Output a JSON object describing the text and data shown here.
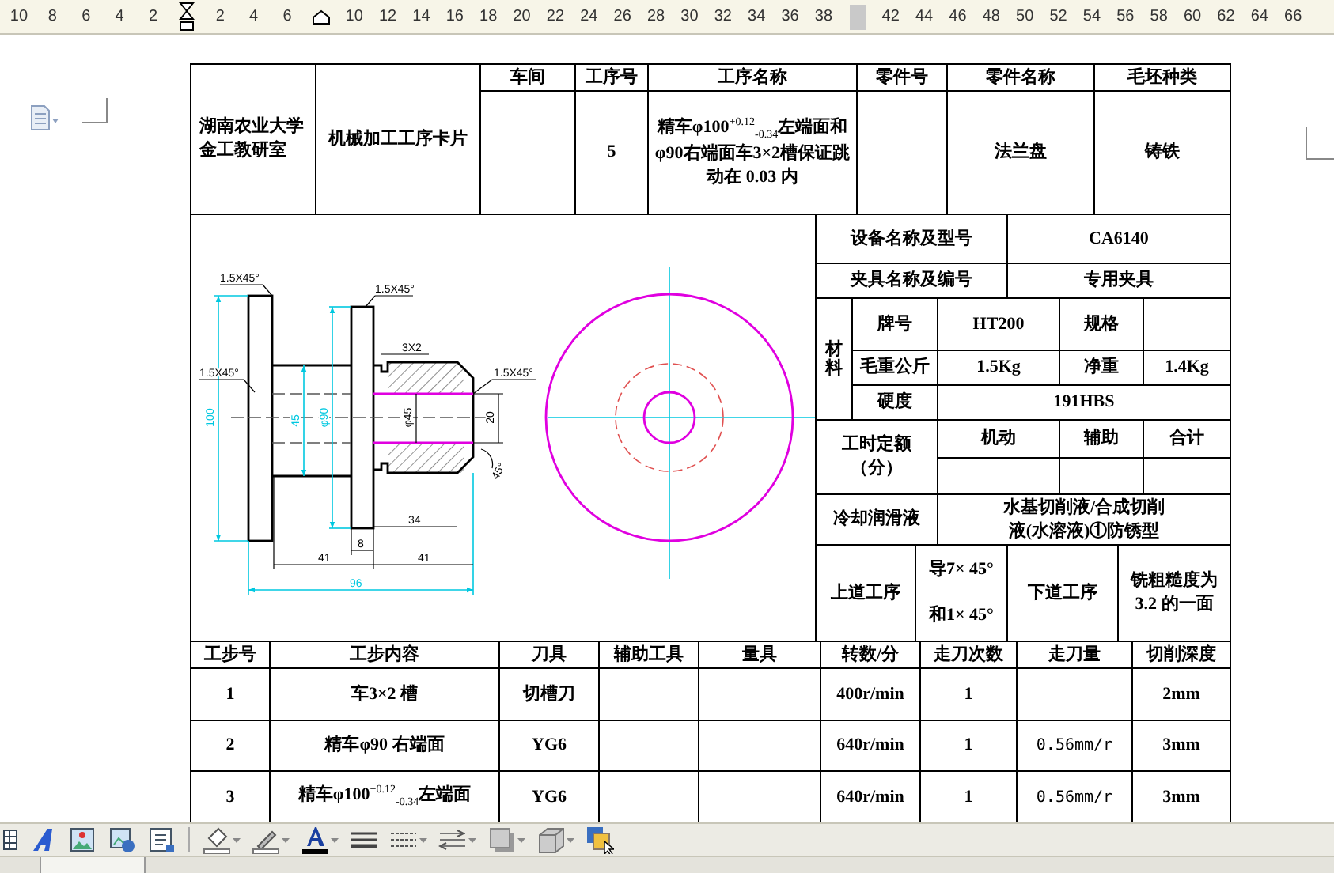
{
  "ruler": {
    "items": [
      {
        "kind": "number",
        "text": "10"
      },
      {
        "kind": "number",
        "text": "8"
      },
      {
        "kind": "number",
        "text": "6"
      },
      {
        "kind": "number",
        "text": "4"
      },
      {
        "kind": "number",
        "text": "2"
      },
      {
        "kind": "left_indent"
      },
      {
        "kind": "number",
        "text": "2"
      },
      {
        "kind": "number",
        "text": "4"
      },
      {
        "kind": "number",
        "text": "6"
      },
      {
        "kind": "first_indent"
      },
      {
        "kind": "number",
        "text": "10"
      },
      {
        "kind": "number",
        "text": "12"
      },
      {
        "kind": "number",
        "text": "14"
      },
      {
        "kind": "number",
        "text": "16"
      },
      {
        "kind": "number",
        "text": "18"
      },
      {
        "kind": "number",
        "text": "20"
      },
      {
        "kind": "number",
        "text": "22"
      },
      {
        "kind": "number",
        "text": "24"
      },
      {
        "kind": "number",
        "text": "26"
      },
      {
        "kind": "number",
        "text": "28"
      },
      {
        "kind": "number",
        "text": "30"
      },
      {
        "kind": "number",
        "text": "32"
      },
      {
        "kind": "number",
        "text": "34"
      },
      {
        "kind": "number",
        "text": "36"
      },
      {
        "kind": "number",
        "text": "38"
      },
      {
        "kind": "column_marker"
      },
      {
        "kind": "number",
        "text": "42"
      },
      {
        "kind": "number",
        "text": "44"
      },
      {
        "kind": "number",
        "text": "46"
      },
      {
        "kind": "number",
        "text": "48"
      },
      {
        "kind": "number",
        "text": "50"
      },
      {
        "kind": "number",
        "text": "52"
      },
      {
        "kind": "number",
        "text": "54"
      },
      {
        "kind": "number",
        "text": "56"
      },
      {
        "kind": "number",
        "text": "58"
      },
      {
        "kind": "number",
        "text": "60"
      },
      {
        "kind": "number",
        "text": "62"
      },
      {
        "kind": "number",
        "text": "64"
      },
      {
        "kind": "number",
        "text": "66"
      }
    ]
  },
  "card": {
    "header": {
      "unit": "湖南农业大学金工教研室",
      "title": "机械加工工序卡片",
      "columns": [
        {
          "label": "车间"
        },
        {
          "label": "工序号",
          "value": "5"
        },
        {
          "label": "工序名称",
          "value": "精车φ100$^{+0.12}$$_{-0.34}$左端面和φ90右端面车3×2槽保证跳动在 0.03 内"
        },
        {
          "label": "零件号"
        },
        {
          "label": "零件名称",
          "value": "法兰盘"
        },
        {
          "label": "毛坯种类",
          "value": "铸铁"
        }
      ]
    },
    "drawing": {
      "dimension_labels": [
        "1.5X45°",
        "1.5X45°",
        "1.5X45°",
        "3X2",
        "1.5X45°",
        "100",
        "45",
        "φ90",
        "φ45",
        "20",
        "45°",
        "34",
        "8",
        "41",
        "41",
        "96"
      ]
    },
    "equipment": {
      "label": "设备名称及型号",
      "value": "CA6140"
    },
    "fixture": {
      "label": "夹具名称及编号",
      "value": "专用夹具"
    },
    "material": {
      "label": "材料",
      "grade_label": "牌号",
      "grade": "HT200",
      "spec_label": "规格",
      "gross_label": "毛重公斤",
      "gross": "1.5Kg",
      "net_label": "净重",
      "net": "1.4Kg",
      "hardness_label": "硬度",
      "hardness": "191HBS"
    },
    "time_quota": {
      "label": "工时定额（分）",
      "columns": [
        "机动",
        "辅助",
        "合计"
      ]
    },
    "coolant": {
      "label": "冷却润滑液",
      "value": "水基切削液/合成切削液(水溶液)①防锈型"
    },
    "previous": {
      "label": "上道工序",
      "lines": [
        "导7× 45°",
        "和1× 45°"
      ]
    },
    "next": {
      "label": "下道工序",
      "value": "铣粗糙度为 3.2 的一面"
    },
    "steps": {
      "columns": [
        "工步号",
        "工步内容",
        "刀具",
        "辅助工具",
        "量具",
        "转数/分",
        "走刀次数",
        "走刀量",
        "切削深度"
      ],
      "rows": [
        {
          "step": "1",
          "content": "车3×2 槽",
          "tool": "切槽刀",
          "speed": "400r/min",
          "passes": "1",
          "depth": "2mm"
        },
        {
          "step": "2",
          "content": "精车φ90 右端面",
          "tool": "YG6",
          "speed": "640r/min",
          "passes": "1",
          "feed": "0.56mm/r",
          "depth": "3mm"
        },
        {
          "step": "3",
          "content": "精车φ100$^{+0.12}$$_{-0.34}$左端面",
          "tool": "YG6",
          "speed": "640r/min",
          "passes": "1",
          "feed": "0.56mm/r",
          "depth": "3mm"
        }
      ]
    }
  }
}
